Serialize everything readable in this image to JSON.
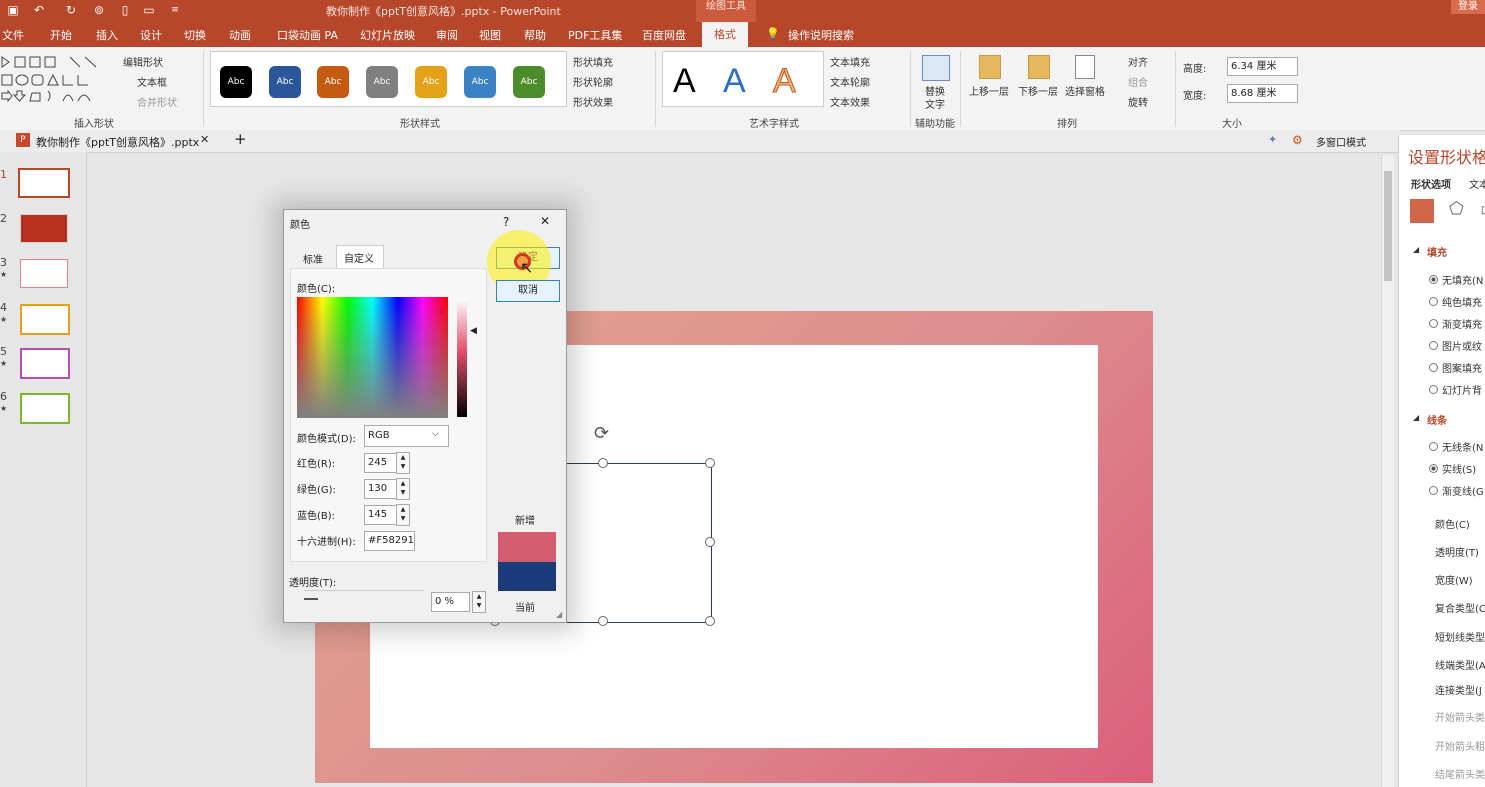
{
  "window": {
    "title": "教你制作《pptT创意风格》.pptx  -  PowerPoint",
    "contextual_group": "绘图工具",
    "login": "登录"
  },
  "tabs": [
    "文件",
    "开始",
    "插入",
    "设计",
    "切换",
    "动画",
    "口袋动画 PA",
    "幻灯片放映",
    "审阅",
    "视图",
    "帮助",
    "PDF工具集",
    "百度网盘",
    "格式"
  ],
  "active_tab": "格式",
  "tell_me": "操作说明搜索",
  "ribbon": {
    "insert_shapes": {
      "label": "插入形状",
      "edit_shape": "编辑形状",
      "text_box": "文本框",
      "merge_shapes": "合并形状"
    },
    "shape_styles": {
      "label": "形状样式",
      "swatch_text": "Abc",
      "fill": "形状填充",
      "outline": "形状轮廓",
      "effects": "形状效果",
      "swatches": [
        "#000000",
        "#2b579a",
        "#c55a11",
        "#808080",
        "#e3a21a",
        "#3b82c4",
        "#4a8d2a"
      ]
    },
    "wordart": {
      "label": "艺术字样式",
      "letter": "A",
      "text_fill": "文本填充",
      "text_outline": "文本轮廓",
      "text_effects": "文本效果"
    },
    "accessibility": {
      "label": "辅助功能",
      "alt_text_1": "替换",
      "alt_text_2": "文字"
    },
    "arrange": {
      "label": "排列",
      "bring_forward": "上移一层",
      "send_backward": "下移一层",
      "selection_pane": "选择窗格",
      "align": "对齐",
      "group": "组合",
      "rotate": "旋转"
    },
    "size": {
      "label": "大小",
      "height_label": "高度:",
      "height": "6.34 厘米",
      "width_label": "宽度:",
      "width": "8.68 厘米"
    }
  },
  "doc_tab": {
    "name": "教你制作《pptT创意风格》.pptx",
    "multi_window": "多窗口模式"
  },
  "slides": [
    {
      "num": "1",
      "star": ""
    },
    {
      "num": "2",
      "star": ""
    },
    {
      "num": "3",
      "star": "★"
    },
    {
      "num": "4",
      "star": "★"
    },
    {
      "num": "5",
      "star": "★"
    },
    {
      "num": "6",
      "star": "★"
    }
  ],
  "format_panel": {
    "title": "设置形状格",
    "tab_shape": "形状选项",
    "tab_text": "文本",
    "fill_header": "填充",
    "fill_options": [
      "无填充(N",
      "纯色填充",
      "渐变填充",
      "图片或纹",
      "图案填充",
      "幻灯片背"
    ],
    "line_header": "线条",
    "line_options": [
      "无线条(N",
      "实线(S)",
      "渐变线(G"
    ],
    "line_props": [
      "颜色(C)",
      "透明度(T)",
      "宽度(W)",
      "复合类型(C",
      "短划线类型",
      "线端类型(A",
      "连接类型(J",
      "开始箭头类",
      "开始箭头粗",
      "结尾箭头类"
    ]
  },
  "color_dialog": {
    "title": "颜色",
    "help": "?",
    "close": "✕",
    "tab_standard": "标准",
    "tab_custom": "自定义",
    "ok": "确定",
    "cancel": "取消",
    "colors_label": "颜色(C):",
    "mode_label": "颜色模式(D):",
    "mode_value": "RGB",
    "red_label": "红色(R):",
    "red": "245",
    "green_label": "绿色(G):",
    "green": "130",
    "blue_label": "蓝色(B):",
    "blue": "145",
    "hex_label": "十六进制(H):",
    "hex": "#F58291",
    "new_label": "新增",
    "current_label": "当前",
    "transparency_label": "透明度(T):",
    "transparency": "0 %",
    "new_color": "#d45c6e",
    "current_color": "#1c3b7a"
  }
}
